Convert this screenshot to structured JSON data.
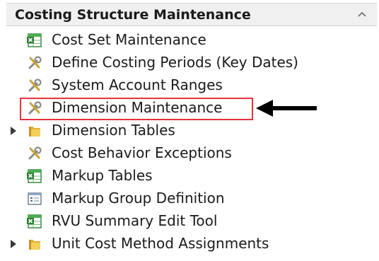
{
  "panel": {
    "title": "Costing Structure Maintenance",
    "collapse_icon": "chevron-up-icon"
  },
  "items": [
    {
      "label": "Cost Set Maintenance",
      "icon": "spreadsheet-icon",
      "expandable": false
    },
    {
      "label": "Define Costing Periods (Key Dates)",
      "icon": "tools-icon",
      "expandable": false
    },
    {
      "label": "System Account Ranges",
      "icon": "tools-icon",
      "expandable": false
    },
    {
      "label": "Dimension Maintenance",
      "icon": "tools-icon",
      "expandable": false,
      "highlighted": true
    },
    {
      "label": "Dimension Tables",
      "icon": "folder-icon",
      "expandable": true
    },
    {
      "label": "Cost Behavior Exceptions",
      "icon": "tools-icon",
      "expandable": false
    },
    {
      "label": "Markup Tables",
      "icon": "spreadsheet-icon",
      "expandable": false
    },
    {
      "label": "Markup Group Definition",
      "icon": "form-icon",
      "expandable": false
    },
    {
      "label": "RVU Summary Edit Tool",
      "icon": "spreadsheet-icon",
      "expandable": false
    },
    {
      "label": "Unit Cost Method Assignments",
      "icon": "folder-icon",
      "expandable": true
    }
  ],
  "colors": {
    "highlight_border": "#e8323c",
    "arrow": "#000000",
    "header_bg": "#f0f0f0"
  }
}
